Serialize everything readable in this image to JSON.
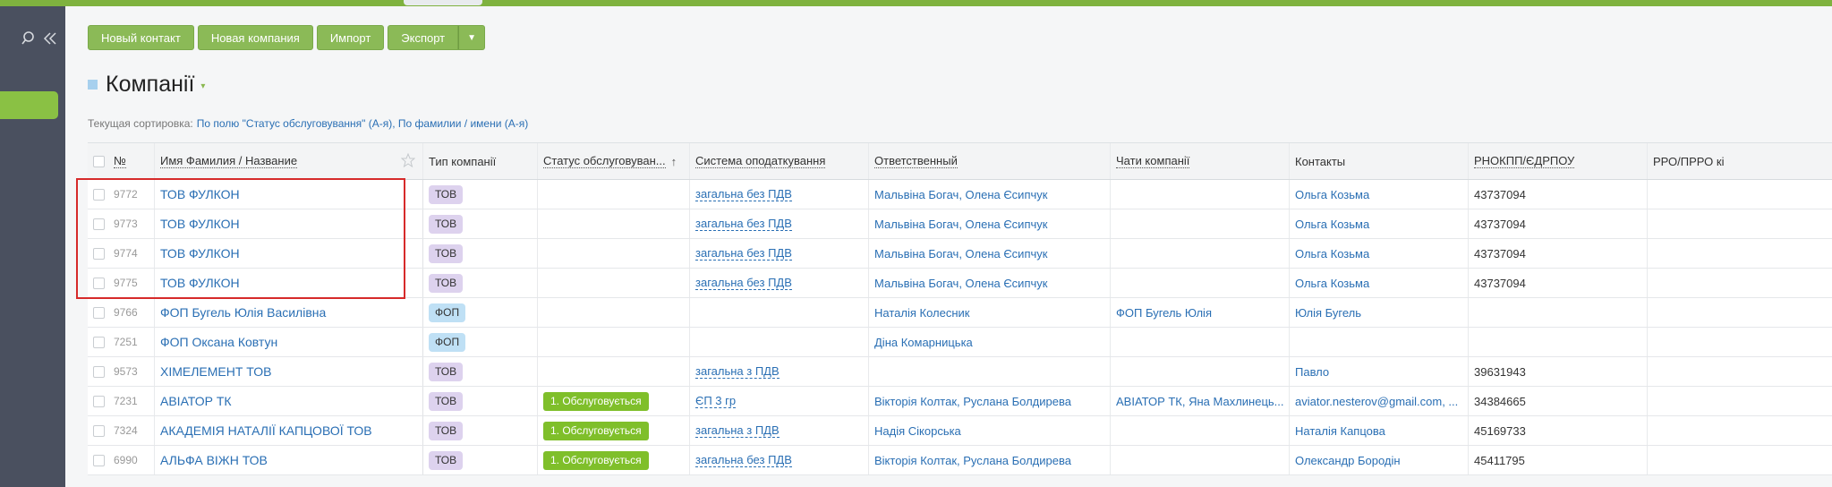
{
  "toolbar": {
    "new_contact": "Новый контакт",
    "new_company": "Новая компания",
    "import": "Импорт",
    "export": "Экспорт",
    "dropdown": "▼"
  },
  "page": {
    "title": "Компанії",
    "title_caret": "▾",
    "sort_label": "Текущая сортировка:",
    "sort_value": "По полю \"Статус обслуговування\" (А-я), По фамилии / имени (А-я)"
  },
  "table": {
    "headers": {
      "num": "№",
      "name": "Имя Фамилия / Название",
      "type": "Тип компанії",
      "status": "Статус обслуговуван...",
      "tax": "Система оподаткування",
      "responsible": "Ответственный",
      "chats": "Чати компанії",
      "contacts": "Контакты",
      "rnokpp": "РНОКПП/ЄДРПОУ",
      "rro": "РРО/ПРРО кі",
      "sort_arrow": "↑"
    },
    "rows": [
      {
        "num": "9772",
        "name": "ТОВ ФУЛКОН",
        "type": "ТОВ",
        "status": "",
        "tax": "загальна без ПДВ",
        "responsible": "Мальвіна Богач, Олена Єсипчук",
        "chats": "",
        "contacts": "Ольга Козьма",
        "rnokpp": "43737094"
      },
      {
        "num": "9773",
        "name": "ТОВ ФУЛКОН",
        "type": "ТОВ",
        "status": "",
        "tax": "загальна без ПДВ",
        "responsible": "Мальвіна Богач, Олена Єсипчук",
        "chats": "",
        "contacts": "Ольга Козьма",
        "rnokpp": "43737094"
      },
      {
        "num": "9774",
        "name": "ТОВ ФУЛКОН",
        "type": "ТОВ",
        "status": "",
        "tax": "загальна без ПДВ",
        "responsible": "Мальвіна Богач, Олена Єсипчук",
        "chats": "",
        "contacts": "Ольга Козьма",
        "rnokpp": "43737094"
      },
      {
        "num": "9775",
        "name": "ТОВ ФУЛКОН",
        "type": "ТОВ",
        "status": "",
        "tax": "загальна без ПДВ",
        "responsible": "Мальвіна Богач, Олена Єсипчук",
        "chats": "",
        "contacts": "Ольга Козьма",
        "rnokpp": "43737094"
      },
      {
        "num": "9766",
        "name": "ФОП Бугель Юлія Василівна",
        "type": "ФОП",
        "status": "",
        "tax": "",
        "responsible": "Наталія Колесник",
        "chats": "ФОП Бугель Юлія",
        "contacts": "Юлія Бугель",
        "rnokpp": ""
      },
      {
        "num": "7251",
        "name": "ФОП Оксана Ковтун",
        "type": "ФОП",
        "status": "",
        "tax": "",
        "responsible": "Діна Комарницька",
        "chats": "",
        "contacts": "",
        "rnokpp": ""
      },
      {
        "num": "9573",
        "name": "ХІМЕЛЕМЕНТ ТОВ",
        "type": "ТОВ",
        "status": "",
        "tax": "загальна з ПДВ",
        "responsible": "",
        "chats": "",
        "contacts": "Павло",
        "rnokpp": "39631943"
      },
      {
        "num": "7231",
        "name": "АВІАТОР ТК",
        "type": "ТОВ",
        "status": "1. Обслуговується",
        "tax": "ЄП 3 гр",
        "responsible": "Вікторія Колтак, Руслана Болдирева",
        "chats": "АВІАТОР ТК, Яна Махлинець...",
        "contacts": "aviator.nesterov@gmail.com, ...",
        "rnokpp": "34384665"
      },
      {
        "num": "7324",
        "name": "АКАДЕМІЯ НАТАЛІЇ КАПЦОВОЇ ТОВ",
        "type": "ТОВ",
        "status": "1. Обслуговується",
        "tax": "загальна з ПДВ",
        "responsible": "Надія Сікорська",
        "chats": "",
        "contacts": "Наталія Капцова",
        "rnokpp": "45169733"
      },
      {
        "num": "6990",
        "name": "АЛЬФА ВІЖН ТОВ",
        "type": "ТОВ",
        "status": "1. Обслуговується",
        "tax": "загальна без ПДВ",
        "responsible": "Вікторія Колтак, Руслана Болдирева",
        "chats": "",
        "contacts": "Олександр Бородін",
        "rnokpp": "45411795"
      }
    ]
  }
}
